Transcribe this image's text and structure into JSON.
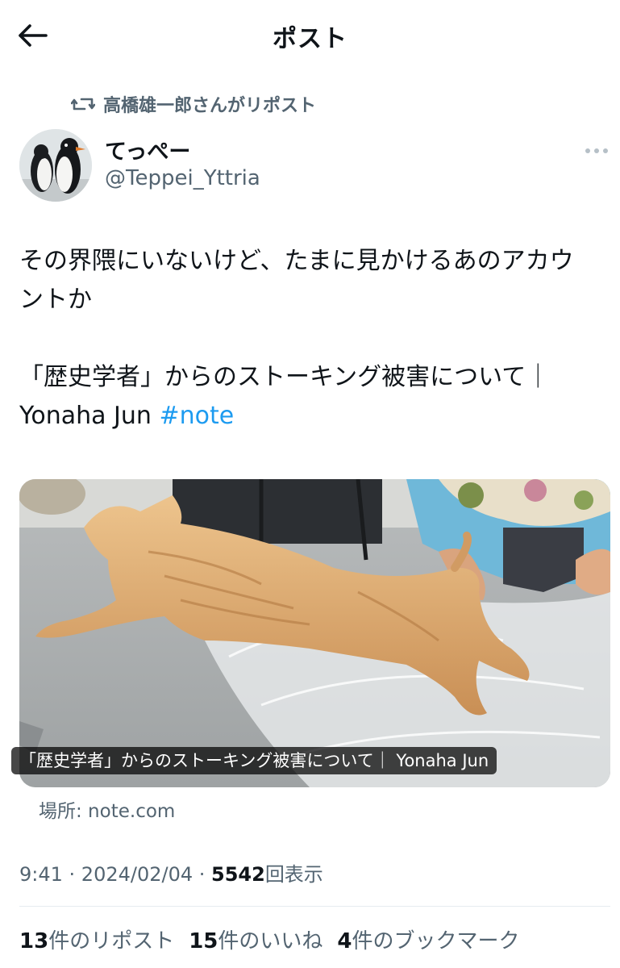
{
  "header": {
    "title": "ポスト"
  },
  "repost": {
    "text": "高橋雄一郎さんがリポスト"
  },
  "author": {
    "display_name": "てっぺー",
    "handle": "@Teppei_Yttria"
  },
  "post": {
    "line1": "その界隈にいないけど、たまに見かけるあのアカウ",
    "line2": "ントか",
    "line3": "「歴史学者」からのストーキング被害について｜",
    "line4_text": "Yonaha Jun ",
    "hashtag": "#note"
  },
  "card": {
    "caption": "「歴史学者」からのストーキング被害について｜ Yonaha Jun",
    "domain": "場所: note.com"
  },
  "meta": {
    "time": "9:41",
    "sep": " · ",
    "date": "2024/02/04",
    "views_count": "5542",
    "views_label": "回表示"
  },
  "stats": {
    "reposts_count": "13",
    "reposts_label": "件のリポスト",
    "likes_count": "15",
    "likes_label": "件のいいね",
    "bookmarks_count": "4",
    "bookmarks_label": "件のブックマーク"
  },
  "colors": {
    "accent": "#1d9bf0",
    "secondary_text": "#536471",
    "primary_text": "#0f1419"
  },
  "icons": {
    "back": "arrow-left-icon",
    "repost": "repost-icon",
    "more": "more-horizontal-icon"
  }
}
